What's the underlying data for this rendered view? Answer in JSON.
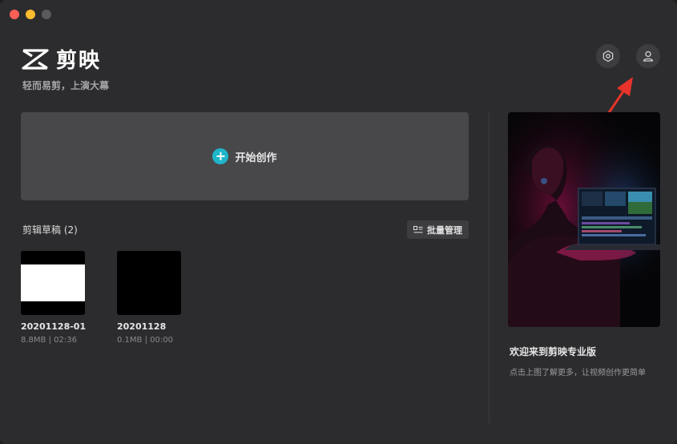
{
  "window": {
    "traffic_lights": [
      "close",
      "minimize",
      "zoom"
    ]
  },
  "brand": {
    "name": "剪映",
    "tagline": "轻而易剪，上演大幕",
    "logo_icon": "capcut-logo-icon"
  },
  "header": {
    "settings_icon": "settings-hexagon-icon",
    "user_icon": "user-icon"
  },
  "create": {
    "label": "开始创作",
    "icon": "plus-icon",
    "accent": "#1fb5c9"
  },
  "drafts": {
    "title": "剪辑草稿 (2)",
    "batch_label": "批量管理",
    "items": [
      {
        "name": "20201128-01",
        "meta": "8.8MB | 02:36"
      },
      {
        "name": "20201128",
        "meta": "0.1MB | 00:00"
      }
    ]
  },
  "promo": {
    "title": "欢迎来到剪映专业版",
    "subtitle": "点击上图了解更多，让视频创作更简单"
  },
  "annotation": {
    "arrow_color": "#e8332a"
  }
}
